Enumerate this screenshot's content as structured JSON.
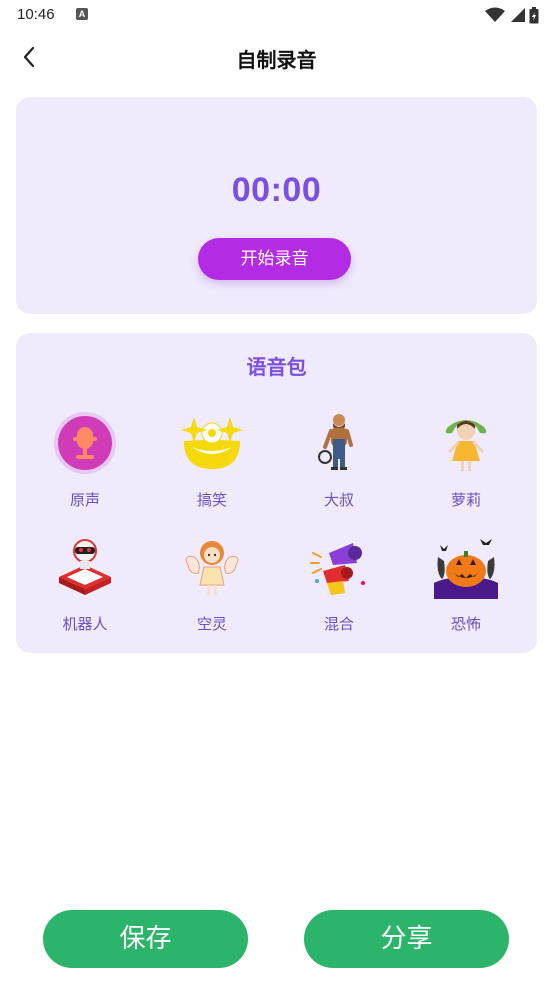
{
  "status_bar": {
    "time": "10:46",
    "notification_glyph": "A",
    "icons": [
      "wifi-icon",
      "signal-icon",
      "battery-icon"
    ]
  },
  "header": {
    "title": "自制录音",
    "back_icon": "back-chevron-icon"
  },
  "recorder": {
    "timer": "00:00",
    "start_label": "开始录音",
    "accent_color": "#7b4fe0",
    "button_color": "#b32ce3"
  },
  "voice_pack": {
    "title": "语音包",
    "selected_index": 0,
    "items": [
      {
        "label": "原声",
        "icon": "microphone-icon"
      },
      {
        "label": "搞笑",
        "icon": "clown-face-icon"
      },
      {
        "label": "大叔",
        "icon": "uncle-figure-icon"
      },
      {
        "label": "萝莉",
        "icon": "girl-figure-icon"
      },
      {
        "label": "机器人",
        "icon": "robot-icon"
      },
      {
        "label": "空灵",
        "icon": "fairy-girl-icon"
      },
      {
        "label": "混合",
        "icon": "megaphone-icon"
      },
      {
        "label": "恐怖",
        "icon": "pumpkin-icon"
      }
    ]
  },
  "actions": {
    "save_label": "保存",
    "share_label": "分享",
    "button_color": "#2cb56a"
  }
}
